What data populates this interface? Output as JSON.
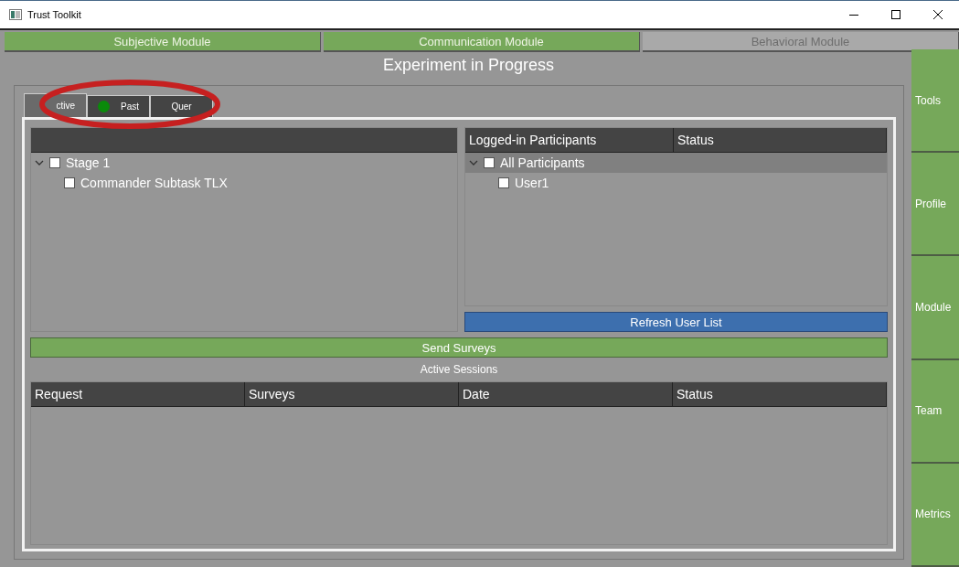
{
  "window": {
    "title": "Trust Toolkit"
  },
  "modules": [
    {
      "label": "Subjective Module",
      "disabled": false
    },
    {
      "label": "Communication Module",
      "disabled": false
    },
    {
      "label": "Behavioral Module",
      "disabled": true
    }
  ],
  "heading": "Experiment in Progress",
  "tabs": [
    {
      "label": "ctive",
      "selected": true,
      "indicator": false
    },
    {
      "label": "Past",
      "selected": false,
      "indicator": true
    },
    {
      "label": "Quer",
      "selected": false,
      "indicator": false
    }
  ],
  "survey_tree": {
    "items": [
      {
        "label": "Stage 1",
        "checked": false,
        "expanded": true,
        "selected": false,
        "children": [
          {
            "label": "Commander Subtask TLX",
            "checked": false,
            "selected": false
          }
        ]
      }
    ]
  },
  "participants": {
    "columns": [
      "Logged-in Participants",
      "Status"
    ],
    "items": [
      {
        "label": "All Participants",
        "checked": false,
        "expanded": true,
        "selected": true,
        "children": [
          {
            "label": "User1",
            "checked": false,
            "selected": false
          }
        ]
      }
    ]
  },
  "refresh_button": "Refresh User List",
  "send_button": "Send Surveys",
  "sessions": {
    "title": "Active Sessions",
    "columns": [
      "Request",
      "Surveys",
      "Date",
      "Status"
    ]
  },
  "sidebar": {
    "items": [
      "Tools",
      "Profile",
      "Module",
      "Team",
      "Metrics"
    ]
  },
  "annotation": {
    "kind": "ellipse",
    "color": "#c62020"
  }
}
